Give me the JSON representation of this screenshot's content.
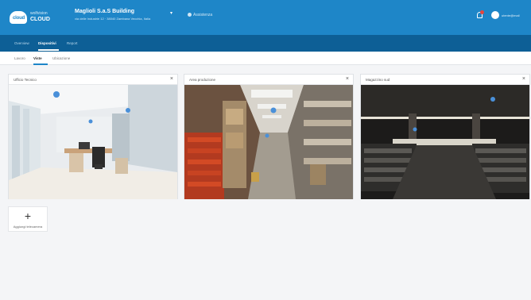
{
  "colors": {
    "topbar": "#1e86c8",
    "subnav": "#0d5f96",
    "accent": "#1e86c8",
    "notification": "#e8453c"
  },
  "brand": {
    "top": "wolfvision",
    "main": "CLOUD",
    "badge": "cloud"
  },
  "header": {
    "building_name": "Maglioli S.a.S Building",
    "building_address": "via delle Industrie 12 · 38040 Zambana Vecchia, Italia",
    "help_label": "Assistenza",
    "user_name": "utente@mail"
  },
  "subnav": {
    "items": [
      "Overview",
      "Dispositivi",
      "Report"
    ],
    "active": 1
  },
  "tabs": {
    "items": [
      "Lavoro",
      "Viste",
      "Ubicazione"
    ],
    "active": 1
  },
  "cameras": [
    {
      "title": "Ufficio Tecnico",
      "close": "×",
      "scene": "office"
    },
    {
      "title": "Area produzione",
      "close": "×",
      "scene": "warehouse"
    },
    {
      "title": "Magazzino sud",
      "close": "×",
      "scene": "hall"
    }
  ],
  "add_view": {
    "icon": "+",
    "label": "Aggiungi telecamera"
  },
  "icons": {
    "notification": "bell-icon",
    "user": "user-icon",
    "help": "help-icon",
    "close": "close-icon",
    "caret": "chevron-down-icon"
  }
}
